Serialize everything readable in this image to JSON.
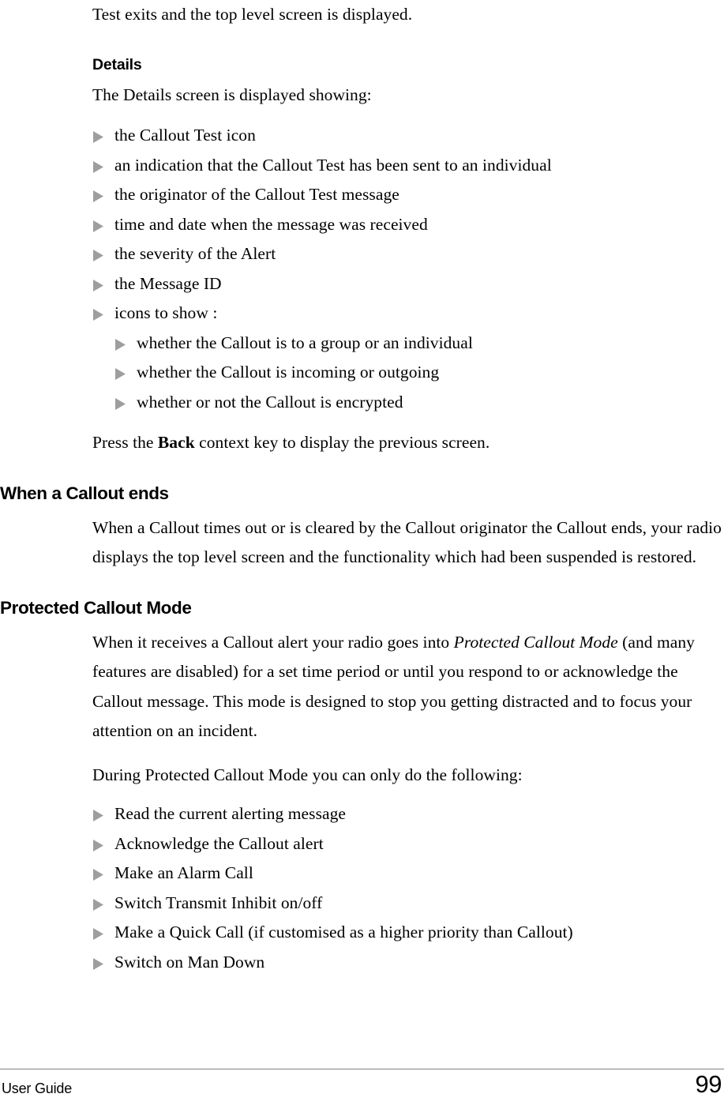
{
  "document": {
    "type": "user-guide-page",
    "bullet_color": "#9e9e9e",
    "rule_color": "#808080",
    "text_color": "#000000",
    "background": "#ffffff"
  },
  "intro": {
    "continued_line": "Test exits and the top level screen is displayed."
  },
  "details_section": {
    "heading": "Details",
    "intro": "The Details screen is displayed showing:",
    "bullets": [
      {
        "text": "the Callout Test icon",
        "level": 1
      },
      {
        "text": "an indication that the Callout Test has been sent to an individual",
        "level": 1
      },
      {
        "text": "the originator of the Callout Test message",
        "level": 1
      },
      {
        "text": "time and date when the message was received",
        "level": 1
      },
      {
        "text": "the severity of the Alert",
        "level": 1
      },
      {
        "text": "the Message ID",
        "level": 1
      },
      {
        "text": "icons to show :",
        "level": 1
      },
      {
        "text": "whether the Callout is to a group or an individual",
        "level": 2
      },
      {
        "text": "whether the Callout is incoming or outgoing",
        "level": 2
      },
      {
        "text": "whether or not the Callout is encrypted",
        "level": 2
      }
    ],
    "closing": {
      "before": "Press the ",
      "bold": "Back",
      "after": " context key to display the previous screen."
    }
  },
  "callout_ends_section": {
    "heading": "When a Callout ends",
    "paragraph": "When a Callout times out or is cleared by the Callout originator the Callout ends, your radio displays the top level screen and the functionality which had been suspended is restored."
  },
  "protected_mode_section": {
    "heading": "Protected Callout Mode",
    "paragraph": {
      "before": "When it receives a Callout alert your radio goes into ",
      "italic": "Protected Callout Mode",
      "after": " (and many features are disabled) for a set time period or until you respond to or acknowledge the Callout message. This mode is designed to stop you getting distracted and to focus your attention on an incident."
    },
    "list_intro": "During Protected Callout Mode you can only do the following:",
    "bullets": [
      {
        "text": "Read the current alerting message",
        "level": 1
      },
      {
        "text": "Acknowledge the Callout alert",
        "level": 1
      },
      {
        "text": "Make an Alarm Call",
        "level": 1
      },
      {
        "text": "Switch Transmit Inhibit on/off",
        "level": 1
      },
      {
        "text": "Make a Quick Call (if customised as a higher priority than Callout)",
        "level": 1
      },
      {
        "text": "Switch on Man Down",
        "level": 1
      }
    ]
  },
  "footer": {
    "left_label": "User Guide",
    "page_number": "99"
  }
}
